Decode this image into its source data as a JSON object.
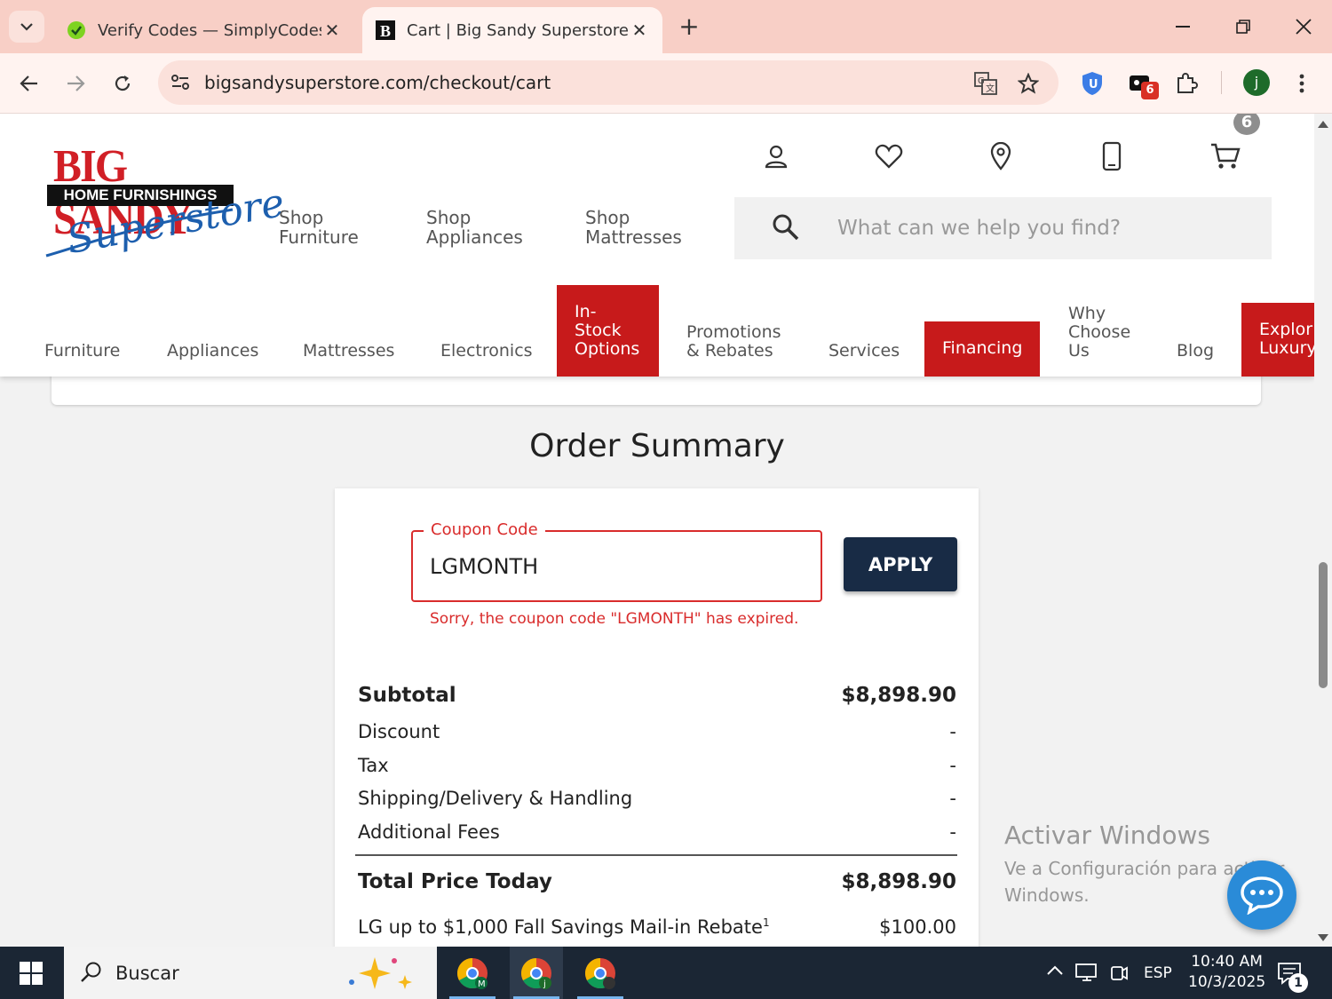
{
  "browser": {
    "tabs": [
      {
        "title": "Verify Codes — SimplyCodes",
        "icon": "simplycodes-icon"
      },
      {
        "title": "Cart | Big Sandy Superstore | Fu",
        "icon": "bigsandy-icon"
      }
    ],
    "url": "bigsandysuperstore.com/checkout/cart",
    "extension_badge": "6",
    "profile_initial": "j"
  },
  "header": {
    "logo": {
      "line1": "BIG SANDY",
      "line2": "HOME FURNISHINGS",
      "line3": "Superstore"
    },
    "shop_links": [
      {
        "line1": "Shop",
        "line2": "Furniture"
      },
      {
        "line1": "Shop",
        "line2": "Appliances"
      },
      {
        "line1": "Shop",
        "line2": "Mattresses"
      }
    ],
    "cart_count": "6",
    "search_placeholder": "What can we help you find?"
  },
  "main_nav": {
    "furniture": "Furniture",
    "appliances": "Appliances",
    "mattresses": "Mattresses",
    "electronics": "Electronics",
    "in_stock": [
      "In-",
      "Stock",
      "Options"
    ],
    "promotions": [
      "Promotions",
      "& Rebates"
    ],
    "services": "Services",
    "financing": "Financing",
    "why": [
      "Why",
      "Choose",
      "Us"
    ],
    "blog": "Blog",
    "explore": [
      "Explor",
      "Luxury"
    ]
  },
  "order_summary": {
    "title": "Order Summary",
    "coupon_label": "Coupon Code",
    "coupon_value": "LGMONTH",
    "apply_label": "APPLY",
    "error": "Sorry, the coupon code \"LGMONTH\" has expired.",
    "lines": [
      {
        "label": "Subtotal",
        "value": "$8,898.90"
      },
      {
        "label": "Discount",
        "value": "-"
      },
      {
        "label": "Tax",
        "value": "-"
      },
      {
        "label": "Shipping/Delivery & Handling",
        "value": "-"
      },
      {
        "label": "Additional Fees",
        "value": "-"
      }
    ],
    "total": {
      "label": "Total Price Today",
      "value": "$8,898.90"
    },
    "rebate": {
      "label": "LG up to $1,000 Fall Savings Mail-in Rebate",
      "footnote": "1",
      "value": "$100.00"
    }
  },
  "watermark": {
    "line1": "Activar Windows",
    "line2": "Ve a Configuración para activar",
    "line3": "Windows."
  },
  "taskbar": {
    "search_label": "Buscar",
    "language": "ESP",
    "time": "10:40 AM",
    "date": "10/3/2025",
    "notification_count": "1"
  },
  "colors": {
    "brand_red": "#c71a1b",
    "apply_navy": "#182b45",
    "error_red": "#d92c2c",
    "tabbar": "#f8cfc6"
  }
}
